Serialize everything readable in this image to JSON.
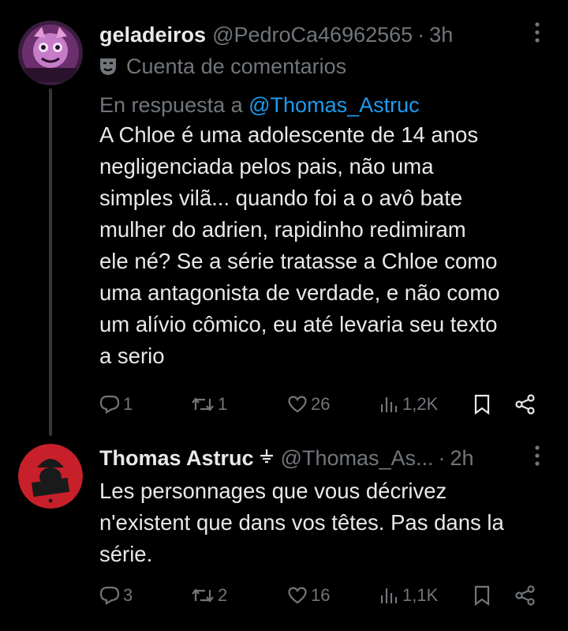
{
  "tweet1": {
    "name": "geladeiros",
    "handle": "@PedroCa46962565",
    "dot": "·",
    "time": "3h",
    "account_label": "Cuenta de comentarios",
    "reply_prefix": "En respuesta a",
    "reply_to": "@Thomas_Astruc",
    "text_lines": [
      "A Chloe é uma adolescente de 14 anos",
      "negligenciada pelos pais, não uma",
      "simples vilã... quando foi a o avô bate",
      "mulher do adrien, rapidinho redimiram",
      "ele né? Se a série tratasse a Chloe como",
      "uma antagonista de verdade, e não como",
      "um alívio cômico, eu até levaria seu texto",
      "a serio"
    ],
    "replies": "1",
    "retweets": "1",
    "likes": "26",
    "views": "1,2K"
  },
  "tweet2": {
    "name": "Thomas Astruc",
    "badge_icon": "verified-ground-icon",
    "handle": "@Thomas_As...",
    "dot": "·",
    "time": "2h",
    "text_lines": [
      "Les personnages que vous décrivez",
      "n'existent que dans vos têtes. Pas dans la",
      "série."
    ],
    "replies": "3",
    "retweets": "2",
    "likes": "16",
    "views": "1,1K"
  },
  "colors": {
    "background": "#000000",
    "text": "#e7e9ea",
    "muted": "#71767b",
    "link": "#1d9bf0"
  }
}
